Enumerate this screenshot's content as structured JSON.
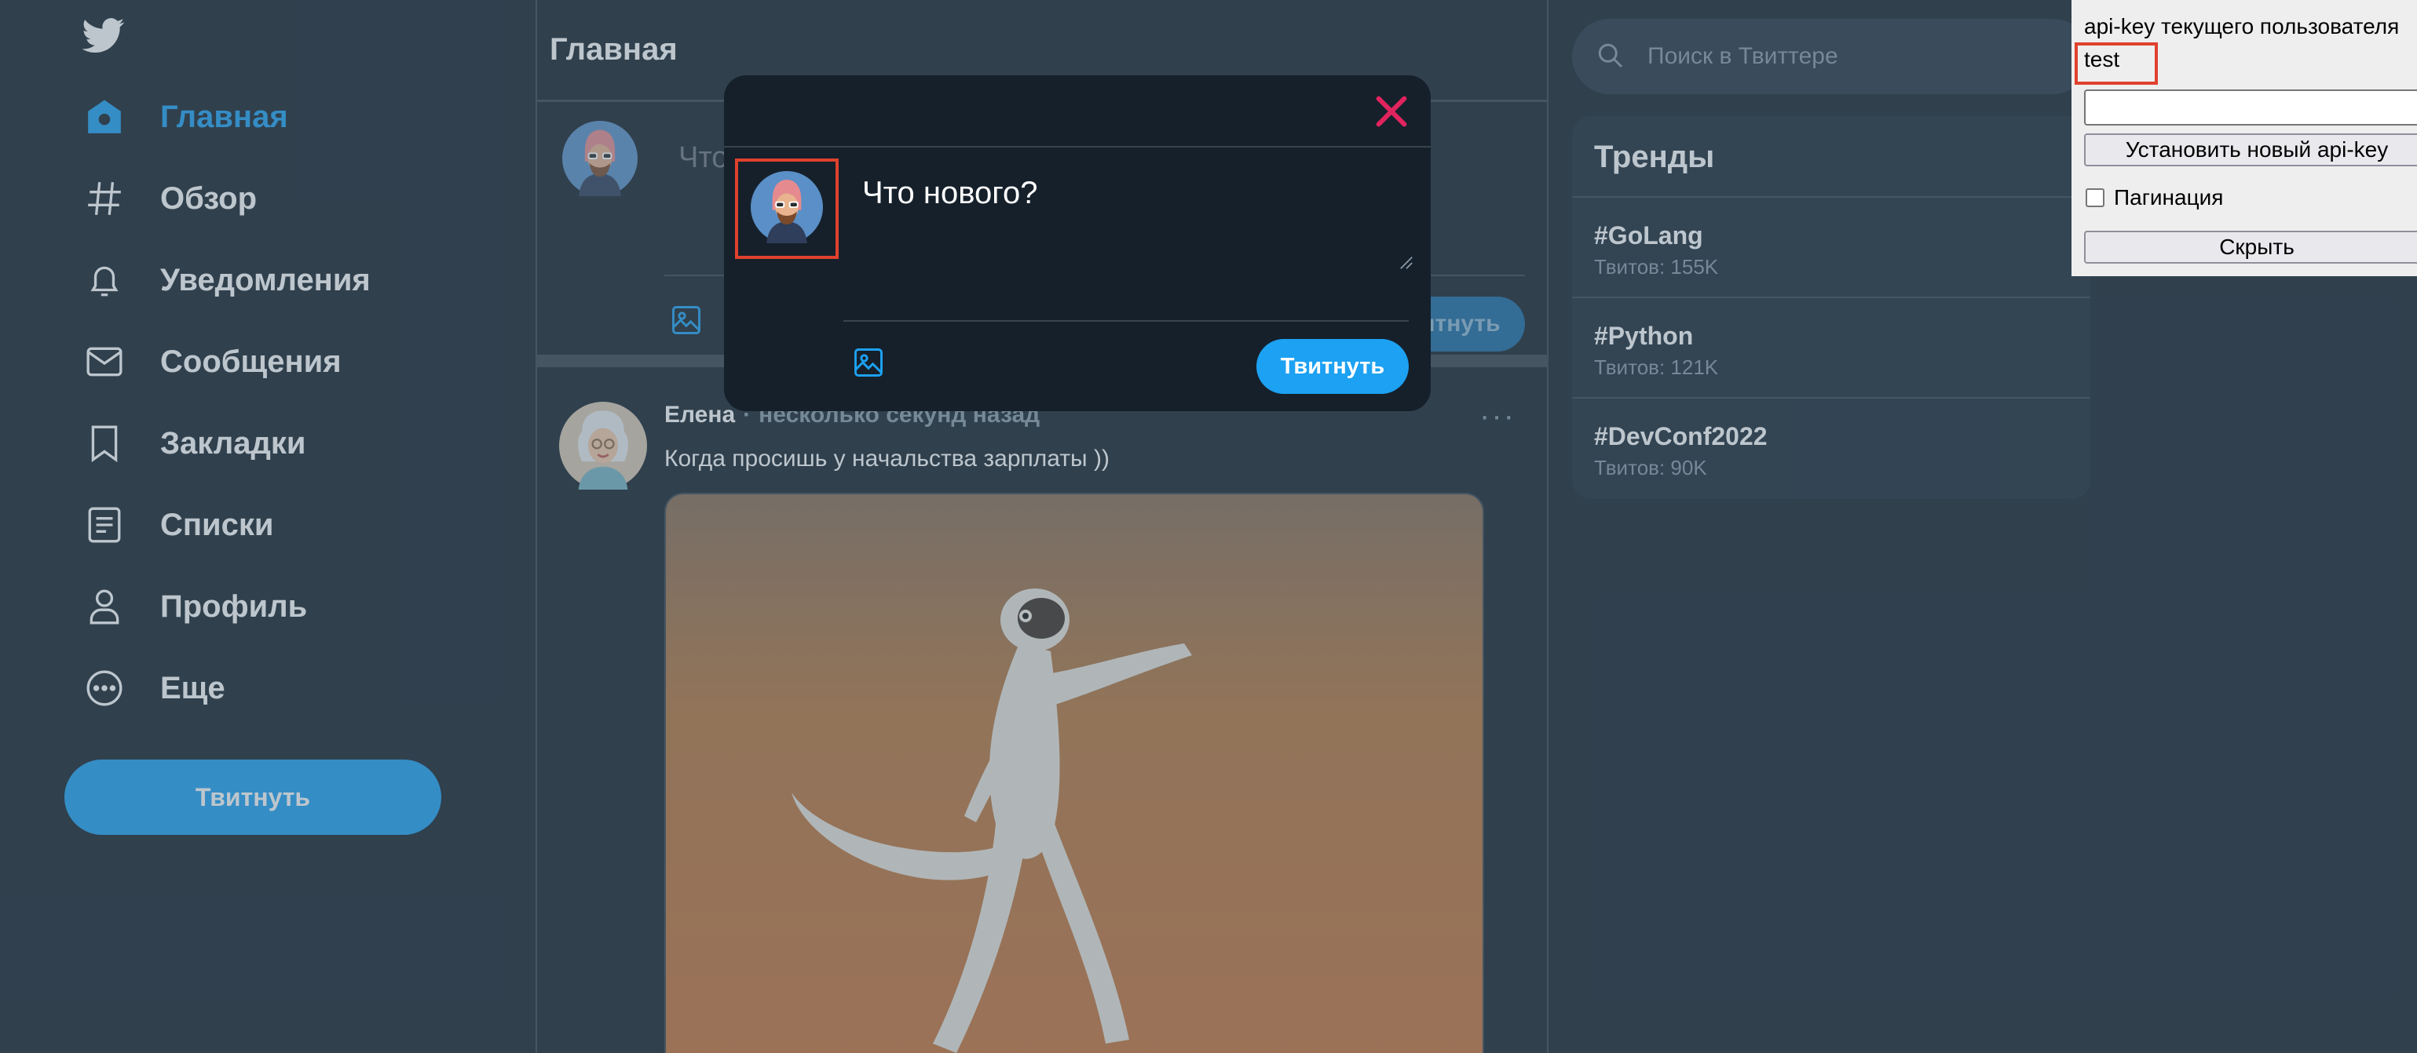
{
  "nav": {
    "logo_icon": "twitter-bird-icon",
    "items": [
      {
        "label": "Главная",
        "icon": "home-icon",
        "active": true
      },
      {
        "label": "Обзор",
        "icon": "hashtag-icon"
      },
      {
        "label": "Уведомления",
        "icon": "bell-icon"
      },
      {
        "label": "Сообщения",
        "icon": "mail-icon"
      },
      {
        "label": "Закладки",
        "icon": "bookmark-icon"
      },
      {
        "label": "Списки",
        "icon": "list-icon"
      },
      {
        "label": "Профиль",
        "icon": "user-icon"
      },
      {
        "label": "Еще",
        "icon": "more-circle-icon"
      }
    ],
    "tweet_button": "Твитнуть"
  },
  "main": {
    "title": "Главная",
    "compose": {
      "placeholder": "Что",
      "tweet_button": "Твитнуть"
    },
    "tweet": {
      "author": "Елена",
      "separator": "·",
      "time": "несколько секунд назад",
      "more": "···",
      "text": "Когда просишь у начальства зарплаты ))"
    }
  },
  "search": {
    "placeholder": "Поиск в Твиттере",
    "icon": "search-icon"
  },
  "trends": {
    "title": "Тренды",
    "items": [
      {
        "tag": "#GoLang",
        "count": "Твитов: 155K"
      },
      {
        "tag": "#Python",
        "count": "Твитов: 121K"
      },
      {
        "tag": "#DevConf2022",
        "count": "Твитов: 90K"
      }
    ]
  },
  "modal": {
    "textarea_value": "Что нового?",
    "tweet_button": "Твитнуть",
    "close_icon": "close-icon"
  },
  "api_panel": {
    "label": "api-key текущего пользователя",
    "current_key": "test",
    "new_key_value": "",
    "set_button": "Установить новый api-key",
    "pagination_label": "Пагинация",
    "pagination_checked": false,
    "hide_button": "Скрыть"
  },
  "colors": {
    "background": "#15202b",
    "accent": "#1da1f2",
    "close": "#e0245e",
    "highlight": "#e0412d"
  }
}
